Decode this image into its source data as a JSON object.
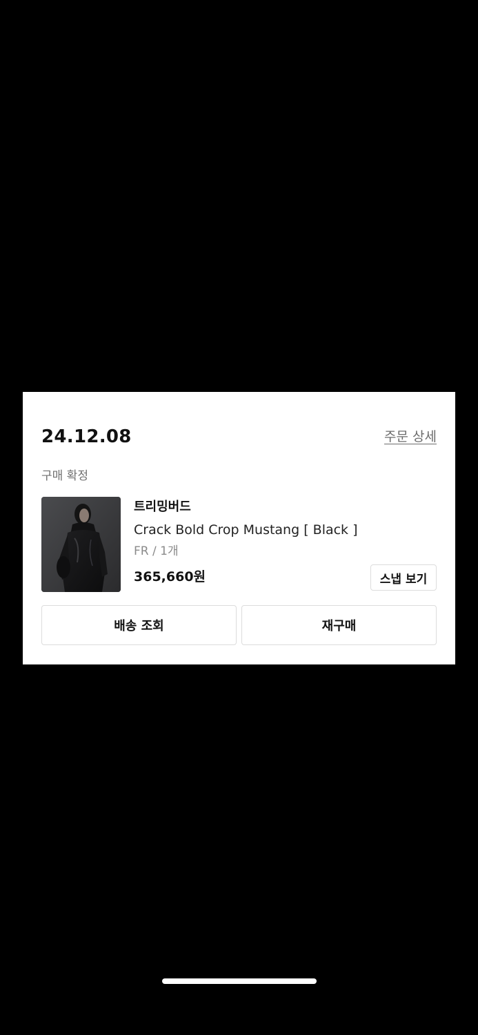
{
  "order": {
    "date": "24.12.08",
    "detail_link": "주문 상세",
    "status": "구매 확정",
    "product": {
      "image_alt": "product photo",
      "brand": "트리밍버드",
      "name": "Crack Bold Crop Mustang [ Black ]",
      "option": "FR / 1개",
      "price": "365,660원",
      "snap_button": "스냅 보기"
    },
    "actions": {
      "track_delivery": "배송 조회",
      "repurchase": "재구매"
    }
  },
  "colors": {
    "background": "#000000",
    "card": "#ffffff",
    "text_primary": "#111111",
    "text_secondary": "#707070",
    "border": "#dcdcdc"
  }
}
